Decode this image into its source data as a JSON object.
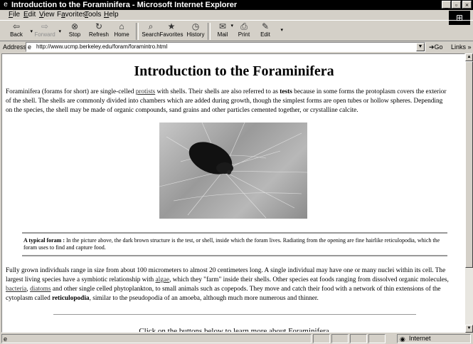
{
  "window": {
    "title": "Introduction to the Foraminifera - Microsoft Internet Explorer"
  },
  "menu": [
    {
      "label": "File",
      "key": "F"
    },
    {
      "label": "Edit",
      "key": "E"
    },
    {
      "label": "View",
      "key": "V"
    },
    {
      "label": "Favorites",
      "key": "a"
    },
    {
      "label": "Tools",
      "key": "T"
    },
    {
      "label": "Help",
      "key": "H"
    }
  ],
  "toolbar": {
    "back": "Back",
    "forward": "Forward",
    "stop": "Stop",
    "refresh": "Refresh",
    "home": "Home",
    "search": "Search",
    "favorites": "Favorites",
    "history": "History",
    "mail": "Mail",
    "print": "Print",
    "edit": "Edit"
  },
  "address": {
    "label": "Address",
    "url": "http://www.ucmp.berkeley.edu/foram/foramintro.html",
    "go": "Go",
    "links": "Links"
  },
  "page": {
    "heading": "Introduction to the Foraminifera",
    "p1": {
      "t1": "Foraminifera (forams for short) are single-celled ",
      "link": "protists",
      "t2": " with shells. Their shells are also referred to as ",
      "bold": "tests",
      "t3": " because in some forms the protoplasm covers the exterior of the shell. The shells are commonly divided into chambers which are added during growth, though the simplest forms are open tubes or hollow spheres. Depending on the species, the shell may be made of organic compounds, sand grains and other particles cemented together, or crystalline calcite."
    },
    "caption": {
      "bold": "A typical foram :",
      "text": " In the picture above, the dark brown structure is the test, or shell, inside which the foram lives. Radiating from the opening are fine hairlike reticulopodia, which the foram uses to find and capture food."
    },
    "p2": {
      "t1": "Fully grown individuals range in size from about 100 micrometers to almost 20 centimeters long. A single individual may have one or many nuclei within its cell. The largest living species have a symbiotic relationship with ",
      "link1": "algae",
      "t2": ", which they \"farm\" inside their shells. Other species eat foods ranging from dissolved organic molecules, ",
      "link2": "bacteria",
      "t3": ", ",
      "link3": "diatoms",
      "t4": " and other single celled phytoplankton, to small animals such as copepods. They move and catch their food with a network of thin extensions of the cytoplasm called ",
      "bold": "reticulopodia",
      "t5": ", similar to the pseudopodia of an amoeba, although much more numerous and thinner."
    },
    "bottom_line": "Click on the buttons below to learn more about Foraminifera"
  },
  "status": {
    "zone": "Internet"
  },
  "colors": {
    "titlebar": "#000000",
    "chrome": "#d4d0c8",
    "page_bg": "#ffffff"
  }
}
